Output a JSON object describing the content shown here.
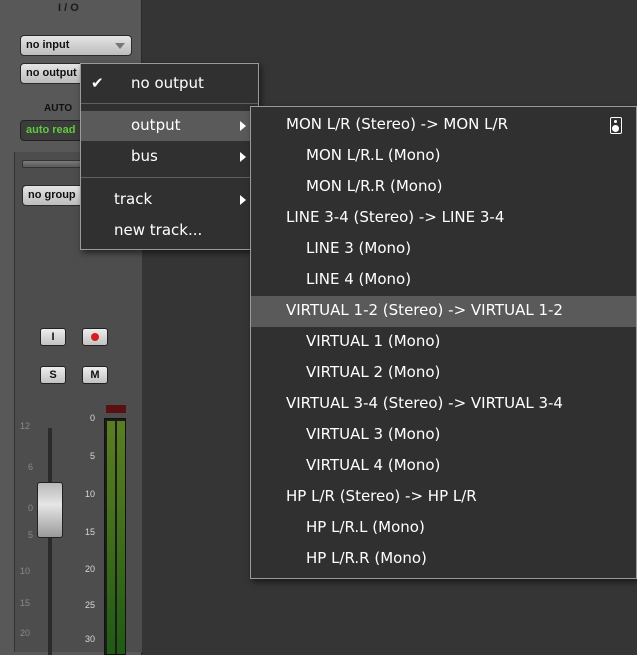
{
  "strip": {
    "io_label": "I / O",
    "input_value": "no input",
    "output_value": "no output",
    "auto_label": "AUTO",
    "auto_value": "auto read",
    "group_value": "no group",
    "input_monitor_label": "I",
    "solo_label": "S",
    "mute_label": "M",
    "fader_scale": [
      "12",
      "6",
      "0",
      "5",
      "10",
      "15",
      "20"
    ],
    "meter_scale": [
      "0",
      "5",
      "10",
      "15",
      "20",
      "25",
      "30"
    ]
  },
  "menu_main": {
    "items": [
      {
        "label": "no output",
        "checked": true
      },
      {
        "label": "output",
        "submenu": true,
        "highlighted": true
      },
      {
        "label": "bus",
        "submenu": true
      },
      {
        "label": "track",
        "submenu": true
      },
      {
        "label": "new track..."
      }
    ]
  },
  "menu_output": {
    "icon": "speaker-icon",
    "items": [
      {
        "label": "MON L/R (Stereo) -> MON L/R"
      },
      {
        "label": "MON L/R.L (Mono)"
      },
      {
        "label": "MON L/R.R (Mono)"
      },
      {
        "label": "LINE 3-4 (Stereo) -> LINE 3-4"
      },
      {
        "label": "LINE 3 (Mono)"
      },
      {
        "label": "LINE 4 (Mono)"
      },
      {
        "label": "VIRTUAL 1-2 (Stereo) -> VIRTUAL 1-2",
        "highlighted": true
      },
      {
        "label": "VIRTUAL 1 (Mono)"
      },
      {
        "label": "VIRTUAL 2 (Mono)"
      },
      {
        "label": "VIRTUAL 3-4 (Stereo) -> VIRTUAL 3-4"
      },
      {
        "label": "VIRTUAL 3 (Mono)"
      },
      {
        "label": "VIRTUAL 4 (Mono)"
      },
      {
        "label": "HP L/R (Stereo) -> HP L/R"
      },
      {
        "label": "HP L/R.L (Mono)"
      },
      {
        "label": "HP L/R.R (Mono)"
      }
    ]
  }
}
